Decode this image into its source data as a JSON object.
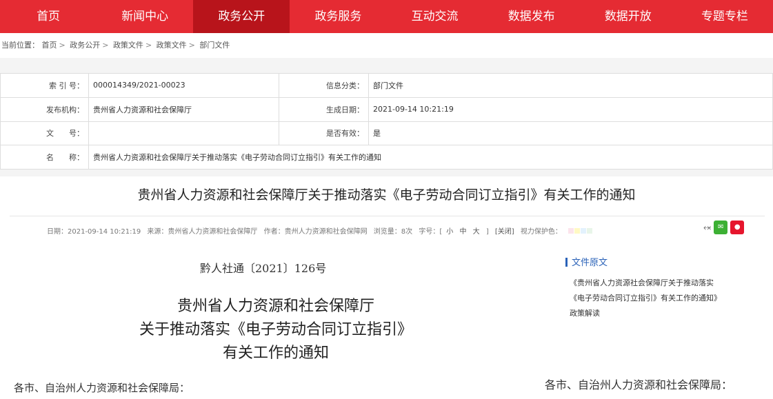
{
  "nav": [
    "首页",
    "新闻中心",
    "政务公开",
    "政务服务",
    "互动交流",
    "数据发布",
    "数据开放",
    "专题专栏"
  ],
  "nav_active": 2,
  "breadcrumb": [
    "当前位置：",
    "首页",
    "政务公开",
    "政策文件",
    "政策文件",
    "部门文件"
  ],
  "meta": {
    "index_label": "索 引 号：",
    "index_value": "000014349/2021-00023",
    "category_label": "信息分类：",
    "category_value": "部门文件",
    "publisher_label": "发布机构：",
    "publisher_value": "贵州省人力资源和社会保障厅",
    "date_label": "生成日期：",
    "date_value": "2021-09-14 10:21:19",
    "docno_label": "文　　号：",
    "docno_value": "",
    "valid_label": "是否有效：",
    "valid_value": "是",
    "name_label": "名　　称：",
    "name_value": "贵州省人力资源和社会保障厅关于推动落实《电子劳动合同订立指引》有关工作的通知"
  },
  "article": {
    "title": "贵州省人力资源和社会保障厅关于推动落实《电子劳动合同订立指引》有关工作的通知",
    "date": "日期：2021-09-14 10:21:19",
    "source": "来源：贵州省人力资源和社会保障厅",
    "author": "作者：贵州人力资源和社会保障网",
    "views": "浏览量：8次",
    "font_size_label": "字号：[",
    "font_small": "小",
    "font_mid": "中",
    "font_large": "大",
    "font_close": "]",
    "close_label": "[关闭]",
    "eye_label": "视力保护色：",
    "doc_number": "黔人社通〔2021〕126号",
    "heading_1": "贵州省人力资源和社会保障厅",
    "heading_2": "关于推动落实《电子劳动合同订立指引》",
    "heading_3": "有关工作的通知",
    "salutation": "各市、自治州人力资源和社会保障局：",
    "salutation_right": "各市、自治州人力资源和社会保障局："
  },
  "sidebar": {
    "heading": "文件原文",
    "items": [
      "《贵州省人力资源社会保障厅关于推动落实",
      "《电子劳动合同订立指引》有关工作的通知》",
      "政策解读"
    ]
  },
  "colors": {
    "nav": "#e52b33",
    "nav_active": "#b8141b",
    "link": "#2a62b8"
  }
}
